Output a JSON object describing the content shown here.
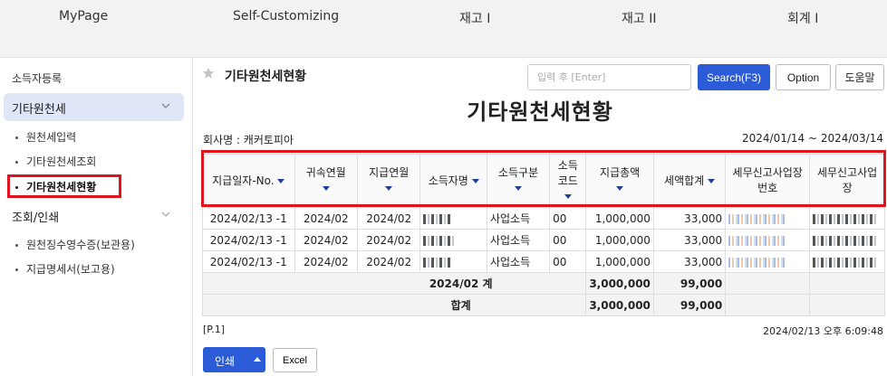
{
  "topnav": [
    "MyPage",
    "Self-Customizing",
    "재고 I",
    "재고 II",
    "회계 I"
  ],
  "sidebar": {
    "section1": "소득자등록",
    "group1": "기타원천세",
    "group1_items": [
      "원천세입력",
      "기타원천세조회",
      "기타원천세현황"
    ],
    "group2": "조회/인쇄",
    "group2_items": [
      "원천징수영수증(보관용)",
      "지급명세서(보고용)"
    ]
  },
  "header": {
    "title": "기타원천세현황",
    "search_placeholder": "입력 후 [Enter]",
    "search_label": "Search(F3)",
    "option_label": "Option",
    "help_label": "도움말"
  },
  "report": {
    "title": "기타원천세현황",
    "company": "회사명 : 캐커토피아",
    "period": "2024/01/14 ~ 2024/03/14"
  },
  "table": {
    "columns": [
      "지급일자-No.",
      "귀속연월",
      "지급연월",
      "소득자명",
      "소득구분",
      "소득\n코드",
      "지급총액",
      "세액합계",
      "세무신고사업장\n번호",
      "세무신고사업\n장"
    ],
    "rows": [
      [
        "2024/02/13 -1",
        "2024/02",
        "2024/02",
        "",
        "사업소득",
        "00",
        "1,000,000",
        "33,000",
        "",
        ""
      ],
      [
        "2024/02/13 -1",
        "2024/02",
        "2024/02",
        "",
        "사업소득",
        "00",
        "1,000,000",
        "33,000",
        "",
        ""
      ],
      [
        "2024/02/13 -1",
        "2024/02",
        "2024/02",
        "",
        "사업소득",
        "00",
        "1,000,000",
        "33,000",
        "",
        ""
      ]
    ],
    "subtotal": {
      "label": "2024/02 계",
      "total_paid": "3,000,000",
      "total_tax": "99,000"
    },
    "total": {
      "label": "합계",
      "total_paid": "3,000,000",
      "total_tax": "99,000"
    }
  },
  "footer": {
    "page": "[P.1]",
    "printed_at": "2024/02/13 오후 6:09:48",
    "print_label": "인쇄",
    "excel_label": "Excel"
  },
  "colors": {
    "accent": "#2b5bd7",
    "highlight": "#e0141c",
    "active_bg": "#dfe6f7"
  }
}
